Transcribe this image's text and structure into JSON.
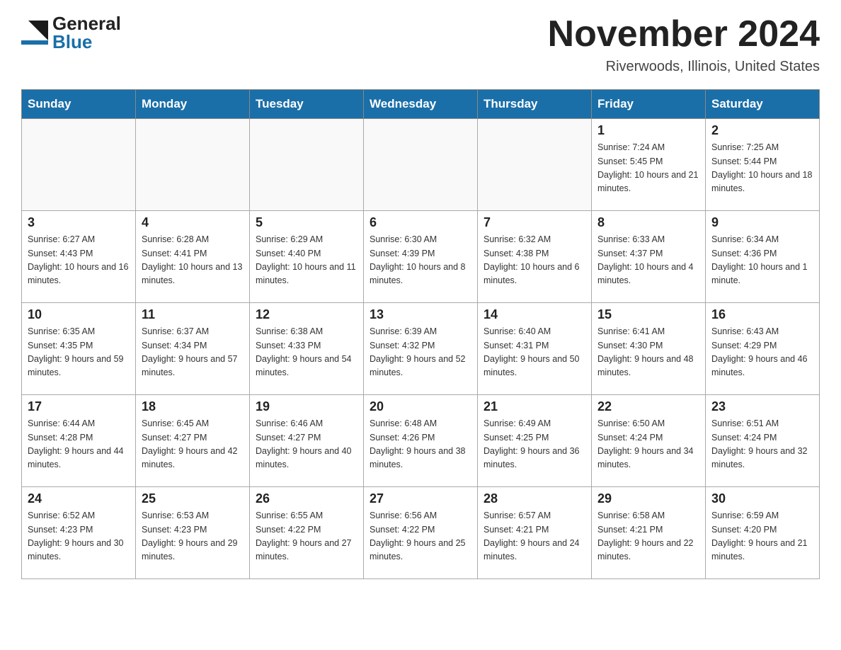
{
  "header": {
    "logo": {
      "general": "General",
      "blue": "Blue"
    },
    "title": "November 2024",
    "location": "Riverwoods, Illinois, United States"
  },
  "calendar": {
    "weekdays": [
      "Sunday",
      "Monday",
      "Tuesday",
      "Wednesday",
      "Thursday",
      "Friday",
      "Saturday"
    ],
    "weeks": [
      [
        {
          "day": "",
          "sunrise": "",
          "sunset": "",
          "daylight": ""
        },
        {
          "day": "",
          "sunrise": "",
          "sunset": "",
          "daylight": ""
        },
        {
          "day": "",
          "sunrise": "",
          "sunset": "",
          "daylight": ""
        },
        {
          "day": "",
          "sunrise": "",
          "sunset": "",
          "daylight": ""
        },
        {
          "day": "",
          "sunrise": "",
          "sunset": "",
          "daylight": ""
        },
        {
          "day": "1",
          "sunrise": "Sunrise: 7:24 AM",
          "sunset": "Sunset: 5:45 PM",
          "daylight": "Daylight: 10 hours and 21 minutes."
        },
        {
          "day": "2",
          "sunrise": "Sunrise: 7:25 AM",
          "sunset": "Sunset: 5:44 PM",
          "daylight": "Daylight: 10 hours and 18 minutes."
        }
      ],
      [
        {
          "day": "3",
          "sunrise": "Sunrise: 6:27 AM",
          "sunset": "Sunset: 4:43 PM",
          "daylight": "Daylight: 10 hours and 16 minutes."
        },
        {
          "day": "4",
          "sunrise": "Sunrise: 6:28 AM",
          "sunset": "Sunset: 4:41 PM",
          "daylight": "Daylight: 10 hours and 13 minutes."
        },
        {
          "day": "5",
          "sunrise": "Sunrise: 6:29 AM",
          "sunset": "Sunset: 4:40 PM",
          "daylight": "Daylight: 10 hours and 11 minutes."
        },
        {
          "day": "6",
          "sunrise": "Sunrise: 6:30 AM",
          "sunset": "Sunset: 4:39 PM",
          "daylight": "Daylight: 10 hours and 8 minutes."
        },
        {
          "day": "7",
          "sunrise": "Sunrise: 6:32 AM",
          "sunset": "Sunset: 4:38 PM",
          "daylight": "Daylight: 10 hours and 6 minutes."
        },
        {
          "day": "8",
          "sunrise": "Sunrise: 6:33 AM",
          "sunset": "Sunset: 4:37 PM",
          "daylight": "Daylight: 10 hours and 4 minutes."
        },
        {
          "day": "9",
          "sunrise": "Sunrise: 6:34 AM",
          "sunset": "Sunset: 4:36 PM",
          "daylight": "Daylight: 10 hours and 1 minute."
        }
      ],
      [
        {
          "day": "10",
          "sunrise": "Sunrise: 6:35 AM",
          "sunset": "Sunset: 4:35 PM",
          "daylight": "Daylight: 9 hours and 59 minutes."
        },
        {
          "day": "11",
          "sunrise": "Sunrise: 6:37 AM",
          "sunset": "Sunset: 4:34 PM",
          "daylight": "Daylight: 9 hours and 57 minutes."
        },
        {
          "day": "12",
          "sunrise": "Sunrise: 6:38 AM",
          "sunset": "Sunset: 4:33 PM",
          "daylight": "Daylight: 9 hours and 54 minutes."
        },
        {
          "day": "13",
          "sunrise": "Sunrise: 6:39 AM",
          "sunset": "Sunset: 4:32 PM",
          "daylight": "Daylight: 9 hours and 52 minutes."
        },
        {
          "day": "14",
          "sunrise": "Sunrise: 6:40 AM",
          "sunset": "Sunset: 4:31 PM",
          "daylight": "Daylight: 9 hours and 50 minutes."
        },
        {
          "day": "15",
          "sunrise": "Sunrise: 6:41 AM",
          "sunset": "Sunset: 4:30 PM",
          "daylight": "Daylight: 9 hours and 48 minutes."
        },
        {
          "day": "16",
          "sunrise": "Sunrise: 6:43 AM",
          "sunset": "Sunset: 4:29 PM",
          "daylight": "Daylight: 9 hours and 46 minutes."
        }
      ],
      [
        {
          "day": "17",
          "sunrise": "Sunrise: 6:44 AM",
          "sunset": "Sunset: 4:28 PM",
          "daylight": "Daylight: 9 hours and 44 minutes."
        },
        {
          "day": "18",
          "sunrise": "Sunrise: 6:45 AM",
          "sunset": "Sunset: 4:27 PM",
          "daylight": "Daylight: 9 hours and 42 minutes."
        },
        {
          "day": "19",
          "sunrise": "Sunrise: 6:46 AM",
          "sunset": "Sunset: 4:27 PM",
          "daylight": "Daylight: 9 hours and 40 minutes."
        },
        {
          "day": "20",
          "sunrise": "Sunrise: 6:48 AM",
          "sunset": "Sunset: 4:26 PM",
          "daylight": "Daylight: 9 hours and 38 minutes."
        },
        {
          "day": "21",
          "sunrise": "Sunrise: 6:49 AM",
          "sunset": "Sunset: 4:25 PM",
          "daylight": "Daylight: 9 hours and 36 minutes."
        },
        {
          "day": "22",
          "sunrise": "Sunrise: 6:50 AM",
          "sunset": "Sunset: 4:24 PM",
          "daylight": "Daylight: 9 hours and 34 minutes."
        },
        {
          "day": "23",
          "sunrise": "Sunrise: 6:51 AM",
          "sunset": "Sunset: 4:24 PM",
          "daylight": "Daylight: 9 hours and 32 minutes."
        }
      ],
      [
        {
          "day": "24",
          "sunrise": "Sunrise: 6:52 AM",
          "sunset": "Sunset: 4:23 PM",
          "daylight": "Daylight: 9 hours and 30 minutes."
        },
        {
          "day": "25",
          "sunrise": "Sunrise: 6:53 AM",
          "sunset": "Sunset: 4:23 PM",
          "daylight": "Daylight: 9 hours and 29 minutes."
        },
        {
          "day": "26",
          "sunrise": "Sunrise: 6:55 AM",
          "sunset": "Sunset: 4:22 PM",
          "daylight": "Daylight: 9 hours and 27 minutes."
        },
        {
          "day": "27",
          "sunrise": "Sunrise: 6:56 AM",
          "sunset": "Sunset: 4:22 PM",
          "daylight": "Daylight: 9 hours and 25 minutes."
        },
        {
          "day": "28",
          "sunrise": "Sunrise: 6:57 AM",
          "sunset": "Sunset: 4:21 PM",
          "daylight": "Daylight: 9 hours and 24 minutes."
        },
        {
          "day": "29",
          "sunrise": "Sunrise: 6:58 AM",
          "sunset": "Sunset: 4:21 PM",
          "daylight": "Daylight: 9 hours and 22 minutes."
        },
        {
          "day": "30",
          "sunrise": "Sunrise: 6:59 AM",
          "sunset": "Sunset: 4:20 PM",
          "daylight": "Daylight: 9 hours and 21 minutes."
        }
      ]
    ]
  }
}
